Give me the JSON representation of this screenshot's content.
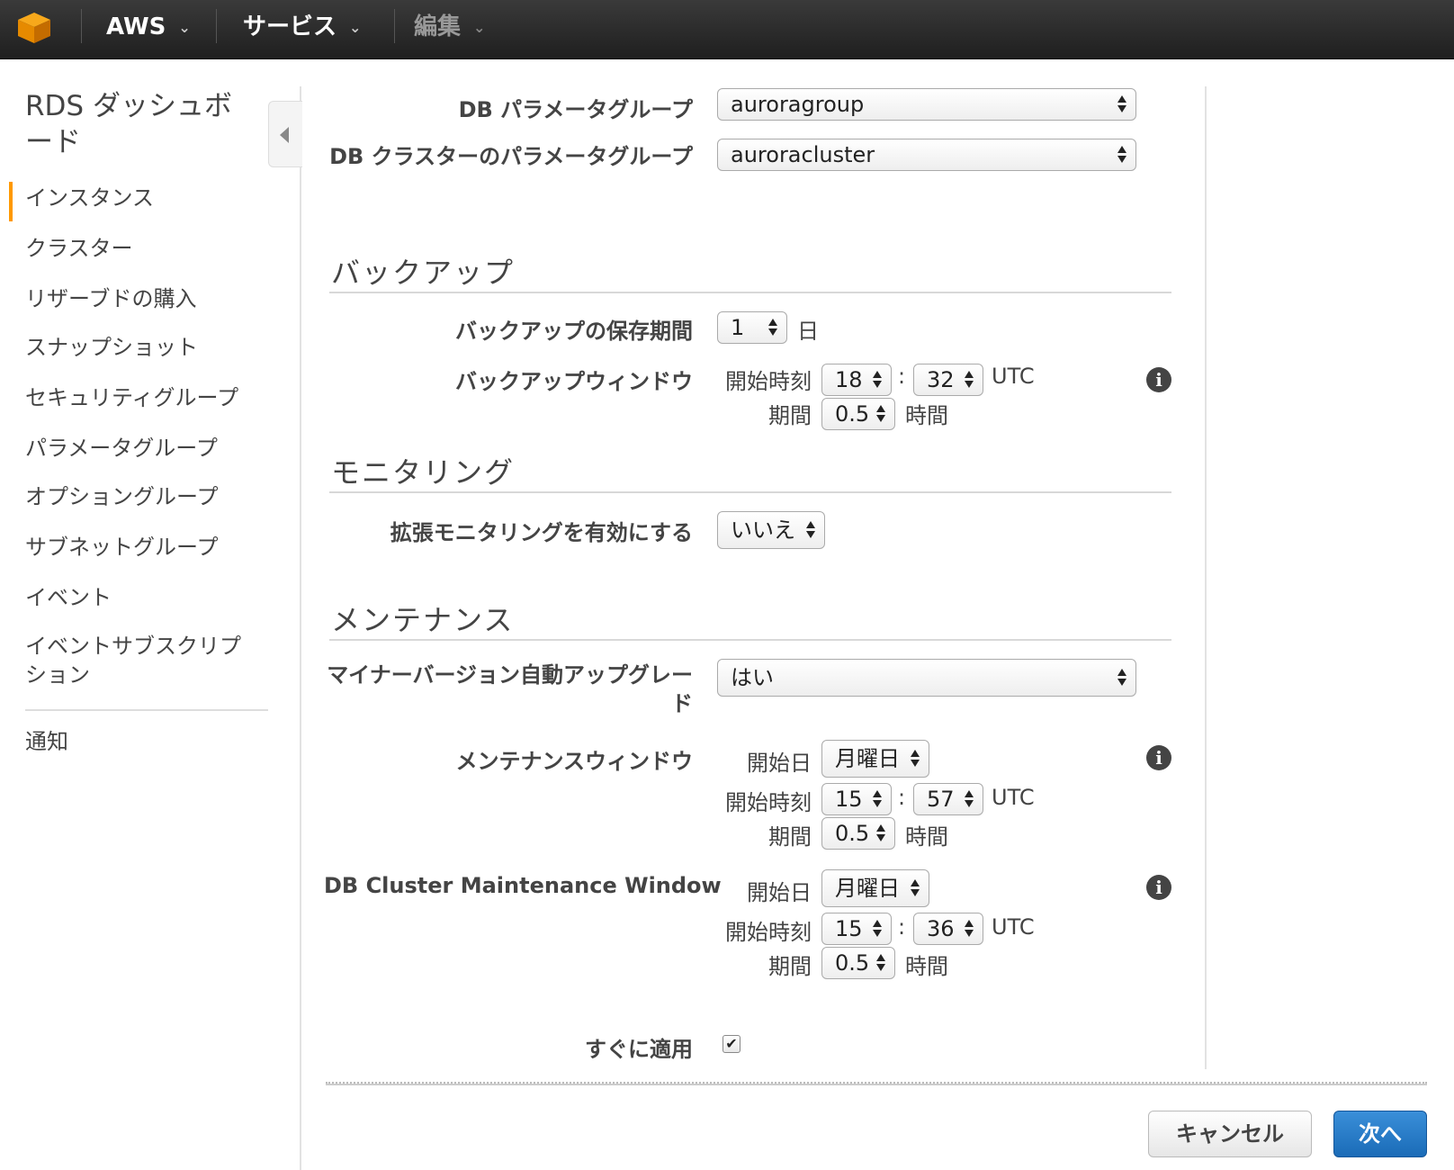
{
  "topbar": {
    "logo": "aws-cube-icon",
    "aws_label": "AWS",
    "services_label": "サービス",
    "edit_label": "編集",
    "chevron": "⌄"
  },
  "sidebar": {
    "title": "RDS ダッシュボード",
    "items": [
      {
        "label": "インスタンス",
        "active": true
      },
      {
        "label": "クラスター"
      },
      {
        "label": "リザーブドの購入"
      },
      {
        "label": "スナップショット"
      },
      {
        "label": "セキュリティグループ"
      },
      {
        "label": "パラメータグループ"
      },
      {
        "label": "オプショングループ"
      },
      {
        "label": "サブネットグループ"
      },
      {
        "label": "イベント"
      },
      {
        "label": "イベントサブスクリプション"
      }
    ],
    "notifications": "通知",
    "accent_color": "#ff9900"
  },
  "form": {
    "db_param_group": {
      "label": "DB パラメータグループ",
      "value": "auroragroup"
    },
    "db_cluster_param_group": {
      "label": "DB クラスターのパラメータグループ",
      "value": "auroracluster"
    },
    "backup": {
      "section": "バックアップ",
      "retention_label": "バックアップの保存期間",
      "retention_value": "1",
      "retention_unit": "日",
      "window_label": "バックアップウィンドウ",
      "start_label": "開始時刻",
      "start_hour": "18",
      "start_minute": "32",
      "tz": "UTC",
      "duration_label": "期間",
      "duration_value": "0.5",
      "duration_unit": "時間"
    },
    "monitoring": {
      "section": "モニタリング",
      "enhanced_label": "拡張モニタリングを有効にする",
      "enhanced_value": "いいえ"
    },
    "maintenance": {
      "section": "メンテナンス",
      "auto_upgrade_label": "マイナーバージョン自動アップグレード",
      "auto_upgrade_value": "はい",
      "window_label": "メンテナンスウィンドウ",
      "day_label": "開始日",
      "day_value": "月曜日",
      "start_label": "開始時刻",
      "start_hour": "15",
      "start_minute": "57",
      "tz": "UTC",
      "duration_label": "期間",
      "duration_value": "0.5",
      "duration_unit": "時間"
    },
    "cluster_maintenance": {
      "window_label": "DB Cluster Maintenance Window",
      "day_label": "開始日",
      "day_value": "月曜日",
      "start_label": "開始時刻",
      "start_hour": "15",
      "start_minute": "36",
      "tz": "UTC",
      "duration_label": "期間",
      "duration_value": "0.5",
      "duration_unit": "時間"
    },
    "apply_immediately": {
      "label": "すぐに適用",
      "checked": true
    },
    "time_separator": ":",
    "info_glyph": "i"
  },
  "footer": {
    "cancel": "キャンセル",
    "next": "次へ",
    "primary_color": "#1a6bb7"
  }
}
